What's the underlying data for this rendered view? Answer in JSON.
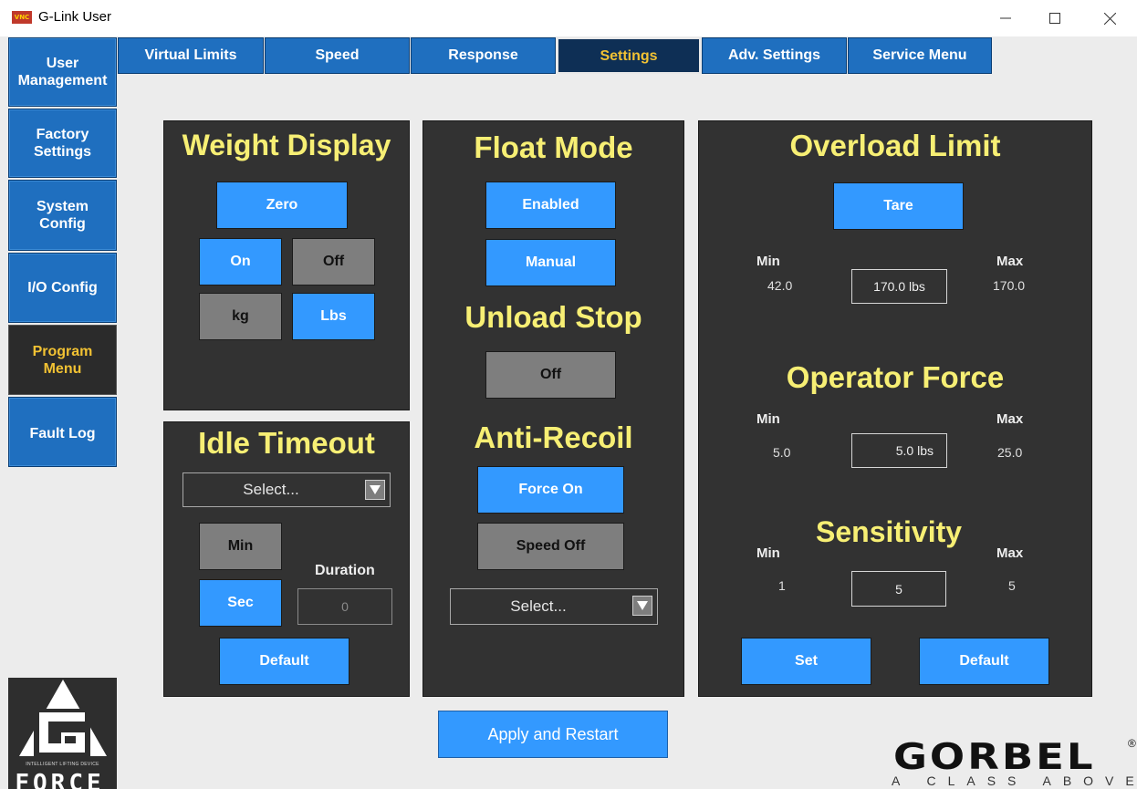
{
  "window": {
    "title": "G-Link User",
    "icon_text": "VNC"
  },
  "nav": [
    {
      "label": "User\nManagement",
      "active": false
    },
    {
      "label": "Factory\nSettings",
      "active": false
    },
    {
      "label": "System\nConfig",
      "active": false
    },
    {
      "label": "I/O Config",
      "active": false
    },
    {
      "label": "Program\nMenu",
      "active": true
    },
    {
      "label": "Fault Log",
      "active": false
    }
  ],
  "tabs": [
    {
      "label": "Virtual Limits",
      "active": false
    },
    {
      "label": "Speed",
      "active": false
    },
    {
      "label": "Response",
      "active": false
    },
    {
      "label": "Settings",
      "active": true
    },
    {
      "label": "Adv. Settings",
      "active": false
    },
    {
      "label": "Service Menu",
      "active": false
    }
  ],
  "weight_display": {
    "title": "Weight Display",
    "zero_label": "Zero",
    "on_label": "On",
    "off_label": "Off",
    "kg_label": "kg",
    "lbs_label": "Lbs"
  },
  "idle_timeout": {
    "title": "Idle Timeout",
    "select_value": "Select...",
    "min_label": "Min",
    "sec_label": "Sec",
    "duration_label": "Duration",
    "duration_value": "0",
    "default_label": "Default"
  },
  "float_mode": {
    "title": "Float Mode",
    "enabled_label": "Enabled",
    "manual_label": "Manual"
  },
  "unload_stop": {
    "title": "Unload Stop",
    "off_label": "Off"
  },
  "anti_recoil": {
    "title": "Anti-Recoil",
    "force_on_label": "Force On",
    "speed_off_label": "Speed Off",
    "select_value": "Select..."
  },
  "overload_limit": {
    "title": "Overload Limit",
    "tare_label": "Tare",
    "min_label": "Min",
    "max_label": "Max",
    "min_value": "42.0",
    "max_value": "170.0",
    "value": "170.0 lbs"
  },
  "operator_force": {
    "title": "Operator Force",
    "min_label": "Min",
    "max_label": "Max",
    "min_value": "5.0",
    "max_value": "25.0",
    "value": "5.0 lbs"
  },
  "sensitivity": {
    "title": "Sensitivity",
    "min_label": "Min",
    "max_label": "Max",
    "min_value": "1",
    "max_value": "5",
    "value": "5",
    "set_label": "Set",
    "default_label": "Default"
  },
  "apply_label": "Apply and Restart",
  "logos": {
    "gforce_tagline": "INTELLIGENT LIFTING DEVICE",
    "gforce_text": "FORCE",
    "gforce_letter": "G",
    "gorbel_text": "GORBEL",
    "gorbel_tagline": "A CLASS ABOVE",
    "gorbel_mark": "®"
  },
  "colors": {
    "nav_blue": "#1f6fbf",
    "button_blue": "#3399ff",
    "panel_bg": "#323232",
    "title_yellow": "#f7ef74",
    "active_gold": "#f2c233"
  }
}
